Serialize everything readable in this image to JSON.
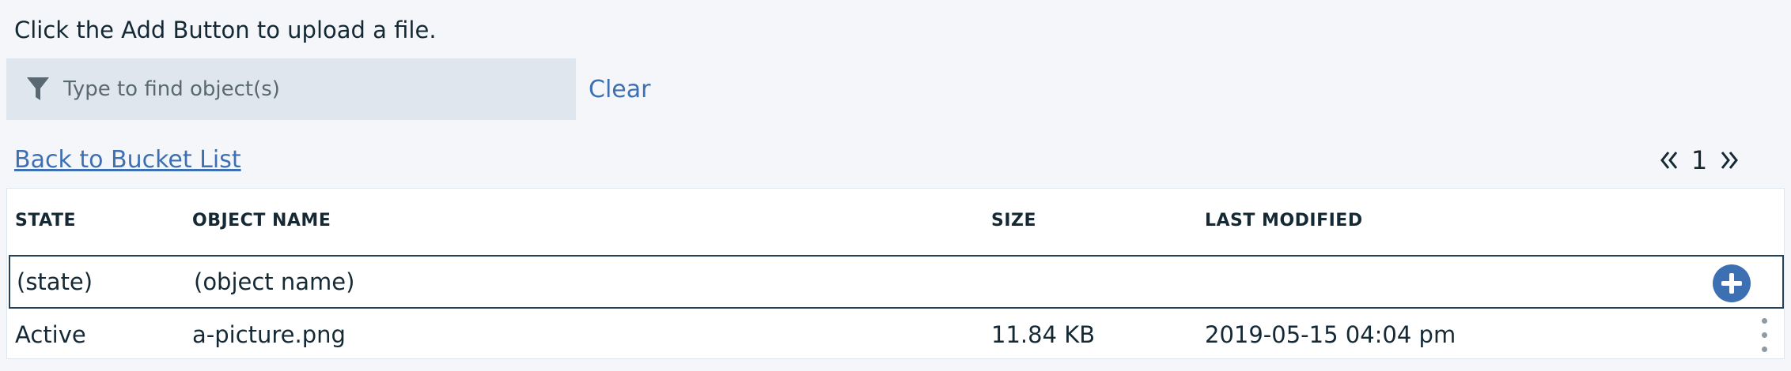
{
  "instructions": "Click the Add Button to upload a file.",
  "filter": {
    "placeholder": "Type to find object(s)",
    "value": "",
    "icon": "filter-icon"
  },
  "clear_label": "Clear",
  "back_link_label": "Back to Bucket List",
  "pagination": {
    "current_page": "1",
    "prev_icon": "double-chevron-left-icon",
    "next_icon": "double-chevron-right-icon"
  },
  "table": {
    "columns": [
      "STATE",
      "OBJECT NAME",
      "SIZE",
      "LAST MODIFIED"
    ],
    "input_row": {
      "state": "(state)",
      "object_name": "(object name)",
      "add_icon": "plus-circle-icon"
    },
    "rows": [
      {
        "state": "Active",
        "object_name": "a-picture.png",
        "size": "11.84 KB",
        "last_modified": "2019-05-15 04:04 pm",
        "menu_icon": "overflow-menu-icon"
      }
    ]
  },
  "colors": {
    "page_bg": "#f4f6fa",
    "link": "#3d70b2",
    "filter_bg": "#dfe6ee",
    "text": "#152935",
    "add_button": "#3d70b2"
  }
}
